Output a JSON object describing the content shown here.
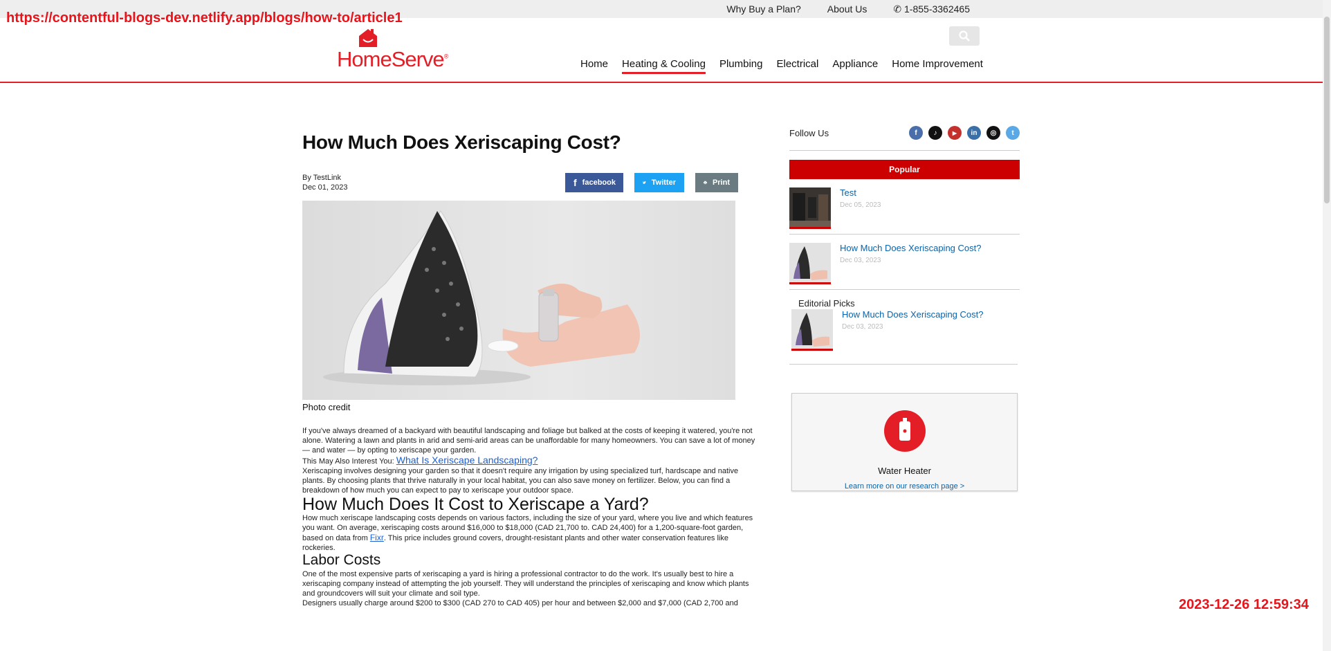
{
  "overlay": {
    "url": "https://contentful-blogs-dev.netlify.app/blogs/how-to/article1",
    "timestamp": "2023-12-26 12:59:34"
  },
  "topbar": {
    "links": [
      "Why Buy a Plan?",
      "About Us"
    ],
    "phone": "1-855-3362465"
  },
  "header": {
    "brand": "HomeServe",
    "nav": [
      "Home",
      "Heating & Cooling",
      "Plumbing",
      "Electrical",
      "Appliance",
      "Home Improvement"
    ],
    "active_nav": "Heating & Cooling"
  },
  "article": {
    "title": "How Much Does Xeriscaping Cost?",
    "author": "By TestLink",
    "date": "Dec 01, 2023",
    "share": {
      "facebook": "facebook",
      "twitter": "Twitter",
      "print": "Print"
    },
    "caption": "Photo credit",
    "p1": "If you've always dreamed of a backyard with beautiful landscaping and foliage but balked at the costs of keeping it watered, you're not alone. Watering a lawn and plants in arid and semi-arid areas can be unaffordable for many homeowners. You can save a lot of money — and water — by opting to xeriscape your garden.",
    "also_prefix": "This May Also Interest You: ",
    "also_link": "What Is Xeriscape Landscaping?",
    "p2": "Xeriscaping involves designing your garden so that it doesn't require any irrigation by using specialized turf, hardscape and native plants. By choosing plants that thrive naturally in your local habitat, you can also save money on fertilizer. Below, you can find a breakdown of how much you can expect to pay to xeriscape your outdoor space.",
    "h2": "How Much Does It Cost to Xeriscape a Yard?",
    "p3a": "How much xeriscape landscaping costs depends on various factors, including the size of your yard, where you live and which features you want. On average, xeriscaping costs around $16,000 to $18,000 (CAD 21,700 to. CAD 24,400) for a 1,200-square-foot garden, based on data from ",
    "p3link": "Fixr",
    "p3b": ". This price includes ground covers, drought-resistant plants and other water conservation features like rockeries.",
    "h3": "Labor Costs",
    "p4": "One of the most expensive parts of xeriscaping a yard is hiring a professional contractor to do the work. It's usually best to hire a xeriscaping company instead of attempting the job yourself. They will understand the principles of xeriscaping and know which plants and groundcovers will suit your climate and soil type.",
    "p5": "Designers usually charge around $200 to $300 (CAD 270 to CAD 405) per hour and between $2,000 and $7,000 (CAD 2,700 and"
  },
  "sidebar": {
    "follow_label": "Follow Us",
    "socials": [
      {
        "name": "facebook",
        "glyph": "f",
        "color": "#4a6ea9"
      },
      {
        "name": "tiktok",
        "glyph": "♪",
        "color": "#111111"
      },
      {
        "name": "youtube",
        "glyph": "▶",
        "color": "#c4302b"
      },
      {
        "name": "linkedin",
        "glyph": "in",
        "color": "#3b6fa8"
      },
      {
        "name": "instagram",
        "glyph": "◎",
        "color": "#111111"
      },
      {
        "name": "twitter",
        "glyph": "t",
        "color": "#5aa9e6"
      }
    ],
    "popular_label": "Popular",
    "popular": [
      {
        "title": "Test",
        "date": "Dec 05, 2023"
      },
      {
        "title": "How Much Does Xeriscaping Cost?",
        "date": "Dec 03, 2023"
      }
    ],
    "editorial_label": "Editorial Picks",
    "editorial": {
      "title": "How Much Does Xeriscaping Cost?",
      "date": "Dec 03, 2023"
    },
    "card": {
      "title": "Water Heater",
      "link": "Learn more on our research page >"
    }
  }
}
